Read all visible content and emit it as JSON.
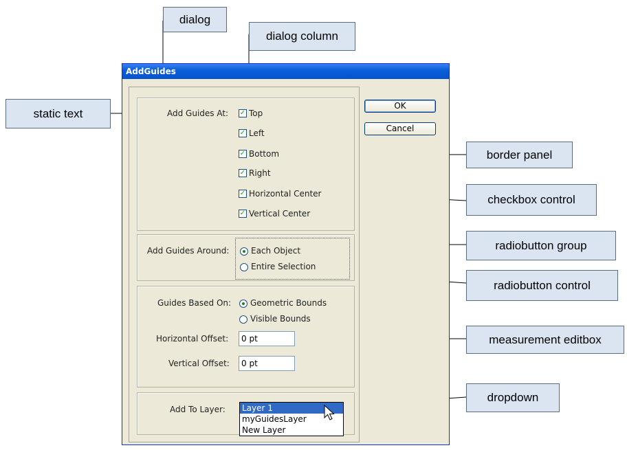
{
  "dialog": {
    "title": "AddGuides",
    "ok_label": "OK",
    "cancel_label": "Cancel",
    "add_guides_at": {
      "label": "Add Guides At:",
      "options": [
        "Top",
        "Left",
        "Bottom",
        "Right",
        "Horizontal Center",
        "Vertical Center"
      ],
      "checked": [
        true,
        true,
        true,
        true,
        true,
        true
      ]
    },
    "add_guides_around": {
      "label": "Add Guides Around:",
      "options": [
        "Each Object",
        "Entire Selection"
      ],
      "selected": "Each Object"
    },
    "guides_based_on": {
      "label": "Guides Based On:",
      "options": [
        "Geometric Bounds",
        "Visible Bounds"
      ],
      "selected": "Geometric Bounds"
    },
    "horizontal_offset": {
      "label": "Horizontal Offset:",
      "value": "0 pt"
    },
    "vertical_offset": {
      "label": "Vertical Offset:",
      "value": "0 pt"
    },
    "add_to_layer": {
      "label": "Add To Layer:",
      "options": [
        "Layer 1",
        "myGuidesLayer",
        "New Layer"
      ],
      "selected": "Layer 1"
    }
  },
  "callouts": {
    "dialog": "dialog",
    "dialog_column": "dialog column",
    "static_text": "static text",
    "border_panel": "border panel",
    "checkbox_control": "checkbox control",
    "radiobutton_group": "radiobutton group",
    "radiobutton_control": "radiobutton control",
    "measurement_editbox": "measurement editbox",
    "dropdown": "dropdown"
  },
  "colors": {
    "callout_fill": "#dbe5f1",
    "title_bar": "#0a5fd8",
    "dialog_bg": "#ece9d8",
    "selection": "#316ac5"
  }
}
